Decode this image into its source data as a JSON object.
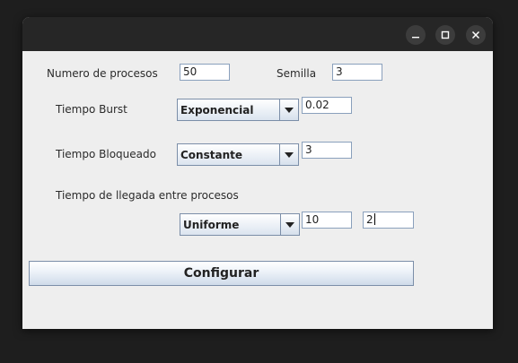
{
  "window": {
    "controls": [
      "minimize-icon",
      "maximize-icon",
      "close-icon"
    ]
  },
  "form": {
    "num_procesos_label": "Numero de procesos",
    "num_procesos_value": "50",
    "semilla_label": "Semilla",
    "semilla_value": "3",
    "burst_label": "Tiempo Burst",
    "burst_dist": "Exponencial",
    "burst_value": "0.02",
    "bloqueado_label": "Tiempo Bloqueado",
    "bloqueado_dist": "Constante",
    "bloqueado_value": "3",
    "llegada_label": "Tiempo de llegada entre procesos",
    "llegada_dist": "Uniforme",
    "llegada_min": "10",
    "llegada_max": "2"
  },
  "actions": {
    "configurar_label": "Configurar"
  }
}
